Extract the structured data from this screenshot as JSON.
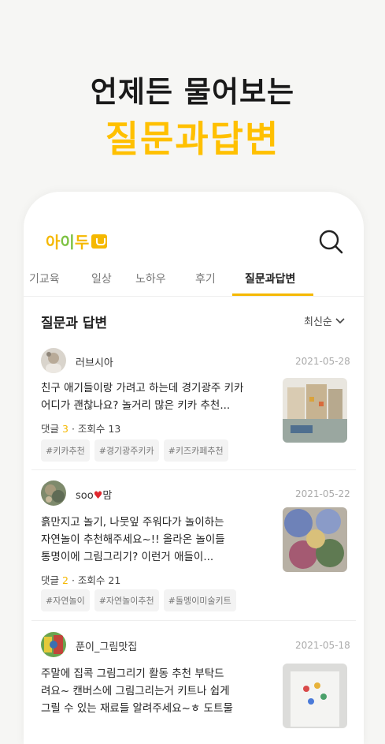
{
  "promo": {
    "line1": "언제든 물어보는",
    "line2": "질문과답변"
  },
  "app": {
    "logo": {
      "part1": "아",
      "part2": "이",
      "part3": "두"
    },
    "tabs": [
      {
        "label": "기교육"
      },
      {
        "label": "일상"
      },
      {
        "label": "노하우"
      },
      {
        "label": "후기"
      },
      {
        "label": "질문과답변",
        "active": true
      }
    ],
    "section_title": "질문과 답변",
    "sort_label": "최신순"
  },
  "posts": [
    {
      "nick": "러브시아",
      "date": "2021-05-28",
      "text_line1": "친구 애기들이랑 가려고 하는데 경기광주 키카",
      "text_line2": "어디가 괜찮나요? 놀거리 많은 키카 추천...",
      "comment_label": "댓글",
      "comment_count": "3",
      "separator": "·",
      "views": "조회수 13",
      "tags": [
        "#키카추천",
        "#경기광주키카",
        "#키즈카페추천"
      ]
    },
    {
      "nick_part1": "soo",
      "nick_heart": "♥",
      "nick_part2": "맘",
      "date": "2021-05-22",
      "text_line1": "흙만지고 놀기, 나뭇잎 주워다가 놀이하는",
      "text_line2": "자연놀이 추천해주세요~!! 올라온 놀이들",
      "text_line3": "통명이에 그림그리기? 이런거 애들이...",
      "comment_label": "댓글",
      "comment_count": "2",
      "separator": "·",
      "views": "조회수 21",
      "tags": [
        "#자연놀이",
        "#자연놀이추천",
        "#돌멩이미술키트"
      ]
    },
    {
      "nick": "푼이_그림맛집",
      "date": "2021-05-18",
      "text_line1": "주말에 집콕 그림그리기 활동 추천 부탁드",
      "text_line2": "려요~ 캔버스에 그림그리는거 키트나 쉽게",
      "text_line3": "그릴 수 있는 재료들 알려주세요~ㅎ 도트물"
    }
  ],
  "colors": {
    "accent": "#ffc000",
    "logo_green": "#7dc242",
    "heart": "#e0282e"
  }
}
